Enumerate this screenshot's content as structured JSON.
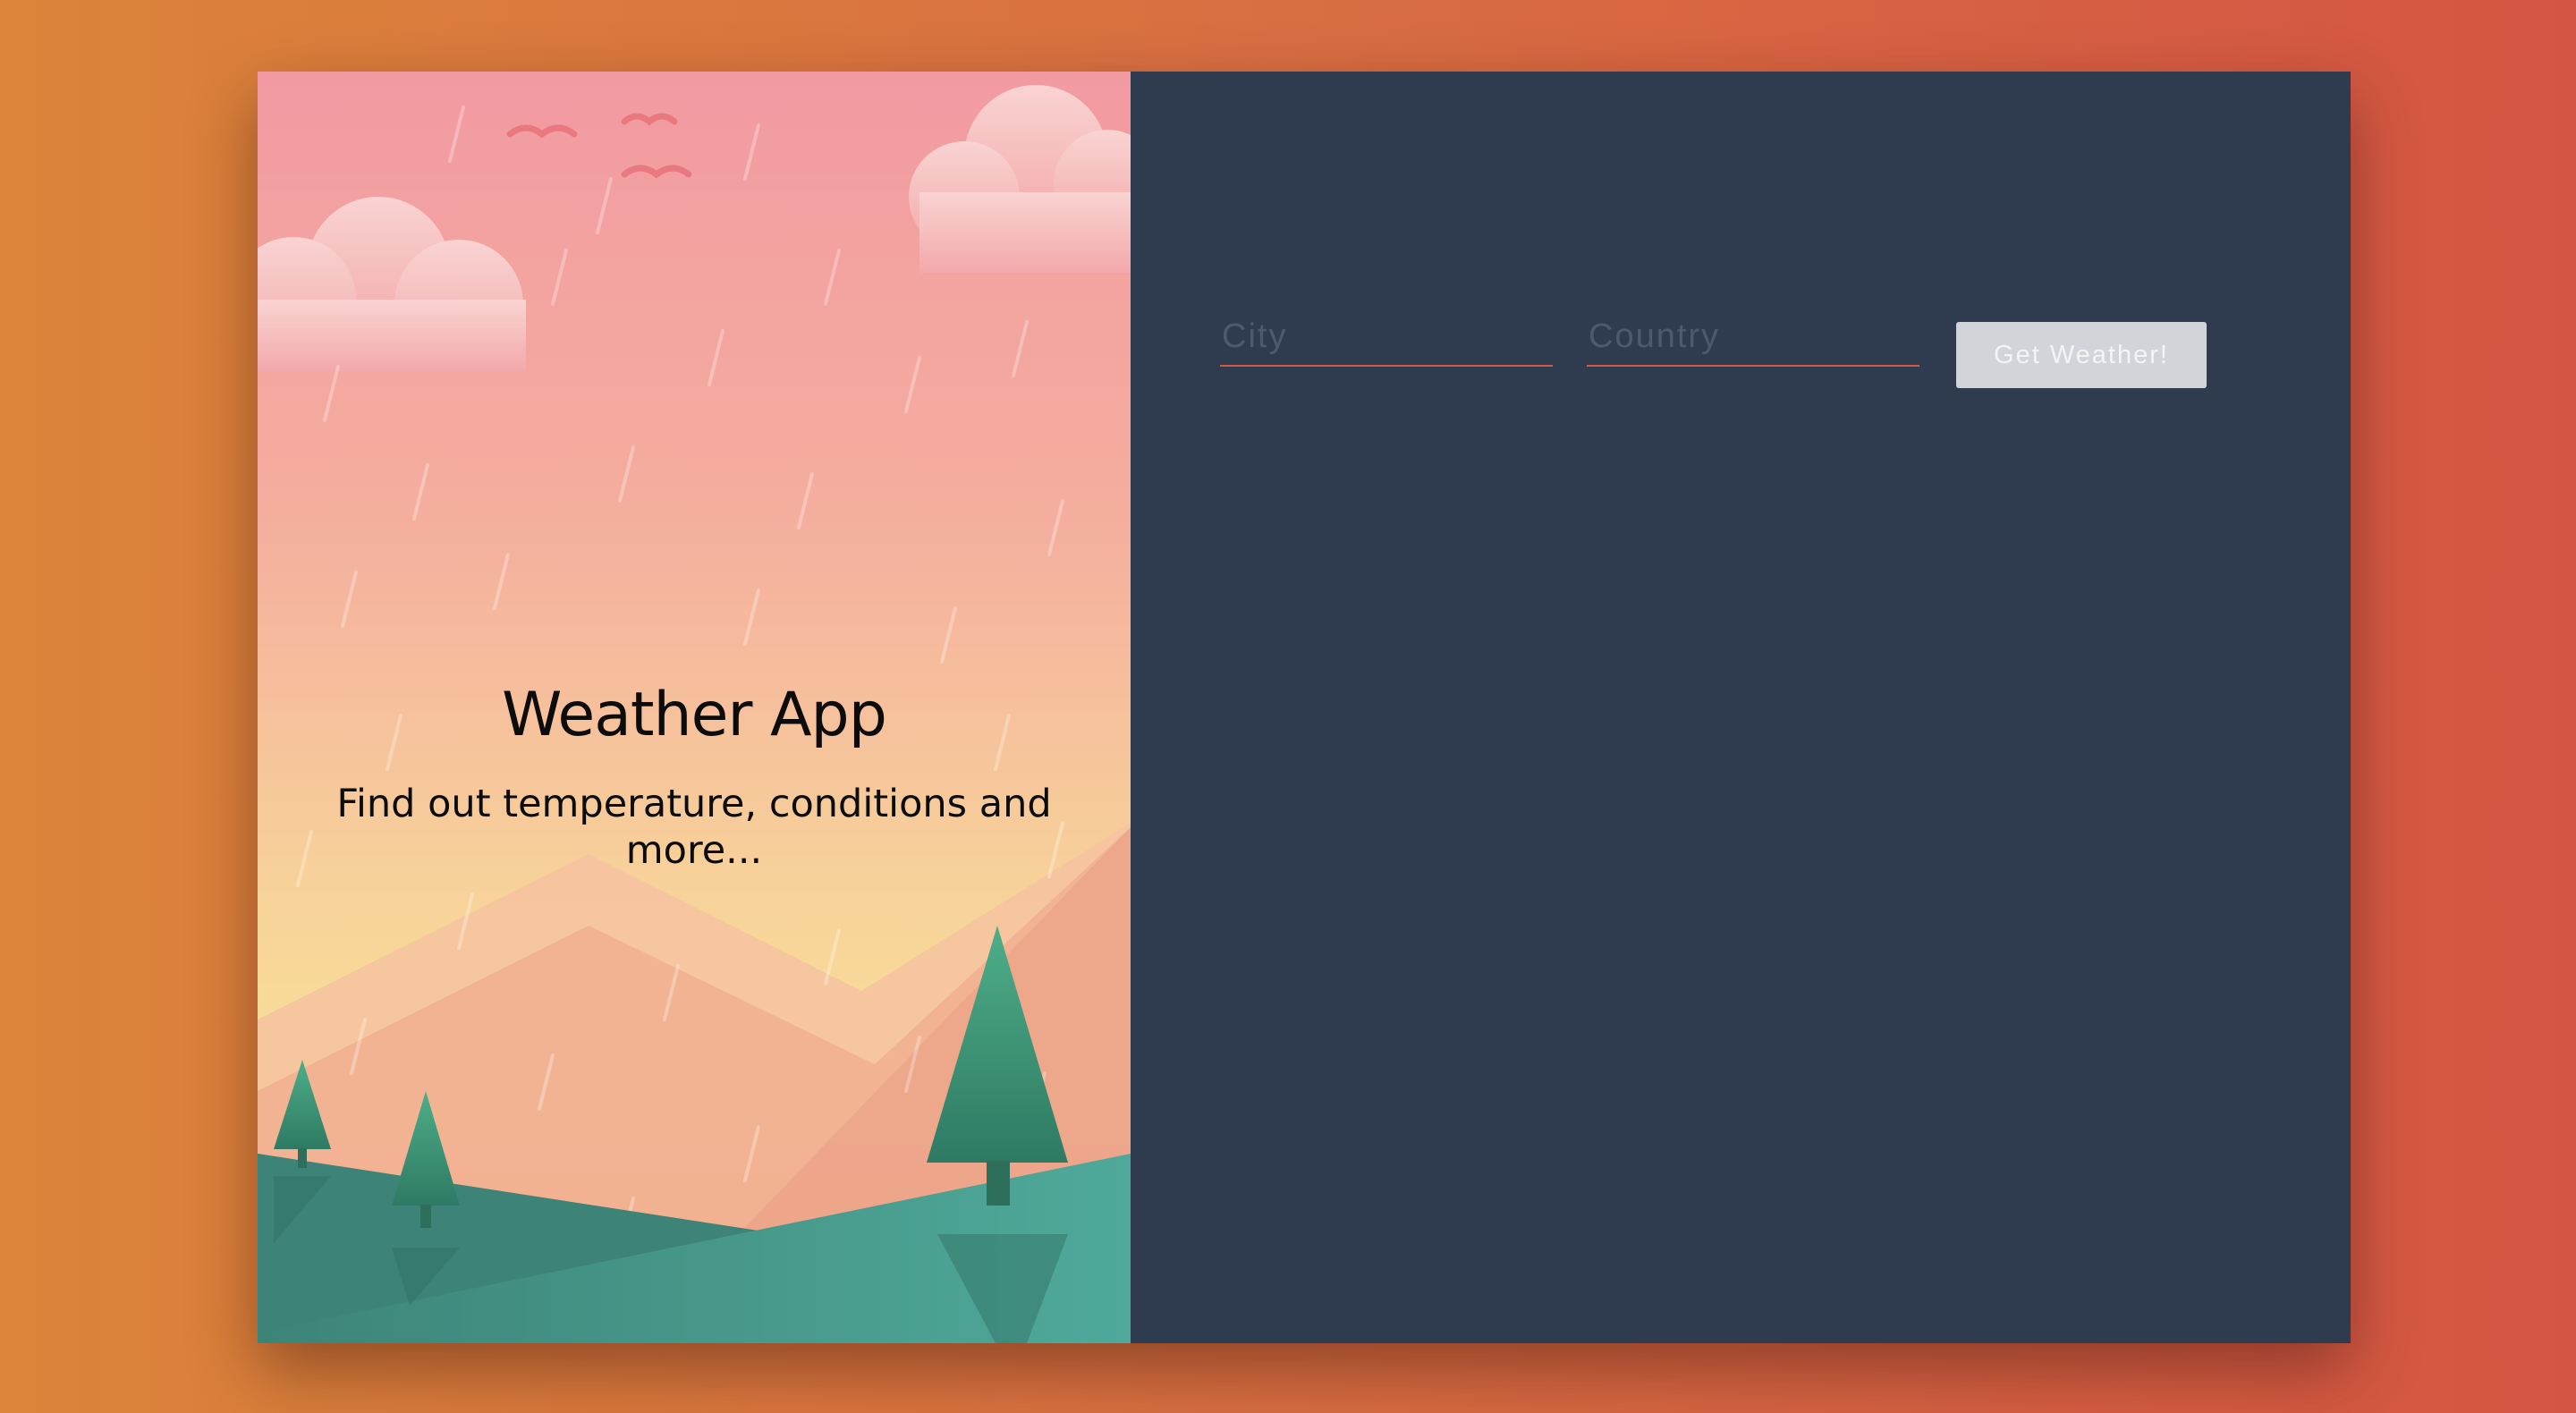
{
  "hero": {
    "title": "Weather App",
    "subtitle": "Find out temperature, conditions and more..."
  },
  "form": {
    "city_placeholder": "City",
    "country_placeholder": "Country",
    "submit_label": "Get Weather!"
  },
  "colors": {
    "background_left": "#db843a",
    "background_right": "#d45544",
    "form_panel": "#2f3c4f",
    "input_underline": "#d35a48",
    "button_bg": "#d1d4d8"
  }
}
